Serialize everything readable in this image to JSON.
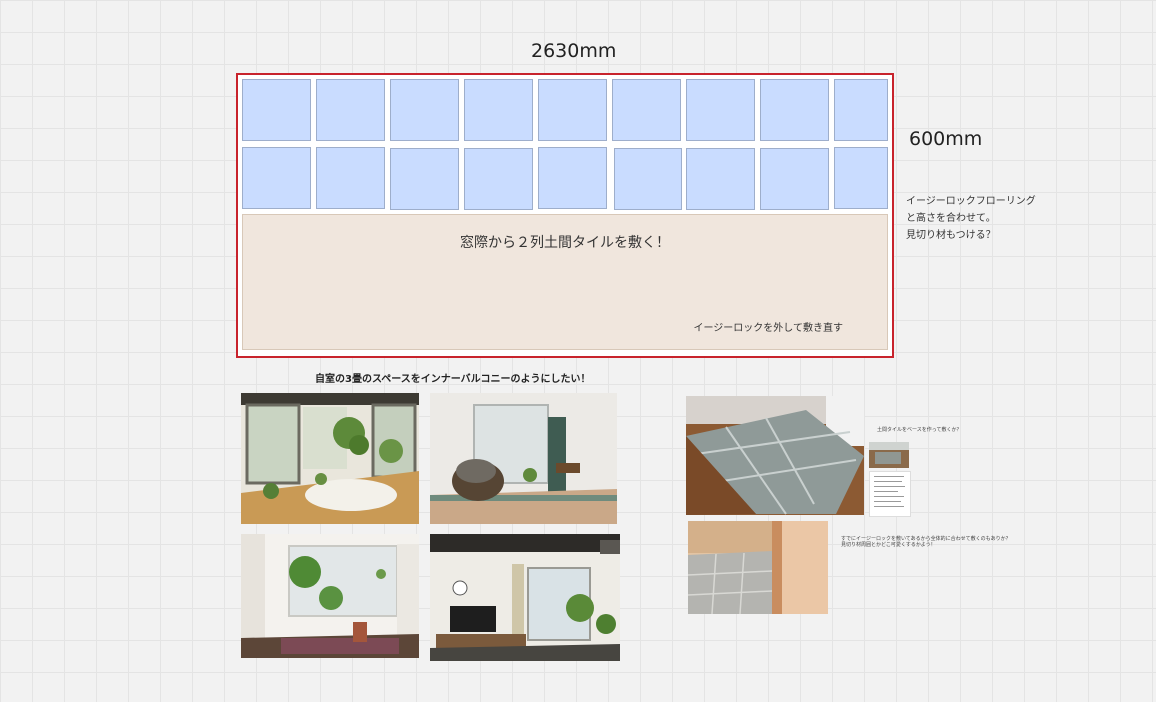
{
  "plan": {
    "width_label": "2630mm",
    "height_label": "600mm",
    "doma_text": "窓際から２列土間タイルを敷く！",
    "easylock_note": "イージーロックを外して敷き直す",
    "tile_rows": 2,
    "tiles_per_row": 9,
    "tile_color": "#c9dcff",
    "doma_color": "#f0e6dd",
    "frame_color": "#c8232c"
  },
  "side_note": {
    "lines": [
      "イージーロックフローリング",
      "と高さを合わせて。",
      "見切り材もつける？"
    ]
  },
  "gallery": {
    "caption": "自室の3畳のスペースをインナーバルコニーのようにしたい！",
    "photos": [
      "sunroom-plants-photo",
      "living-sofa-photo",
      "white-room-plants-photo",
      "loft-living-tv-photo"
    ]
  },
  "references": {
    "note1": "土間タイルをベースを作って敷くか？",
    "note2_line1": "すでにイージーロックを敷いてあるから全体的に合わせて敷くのもありか？",
    "note2_line2": "見切り材周囲とかどこ可愛くするかよう！",
    "photos": [
      "tile-on-parquet-photo",
      "tile-wood-corner-photo",
      "small-doma-thumbnail",
      "article-thumbnail"
    ]
  }
}
